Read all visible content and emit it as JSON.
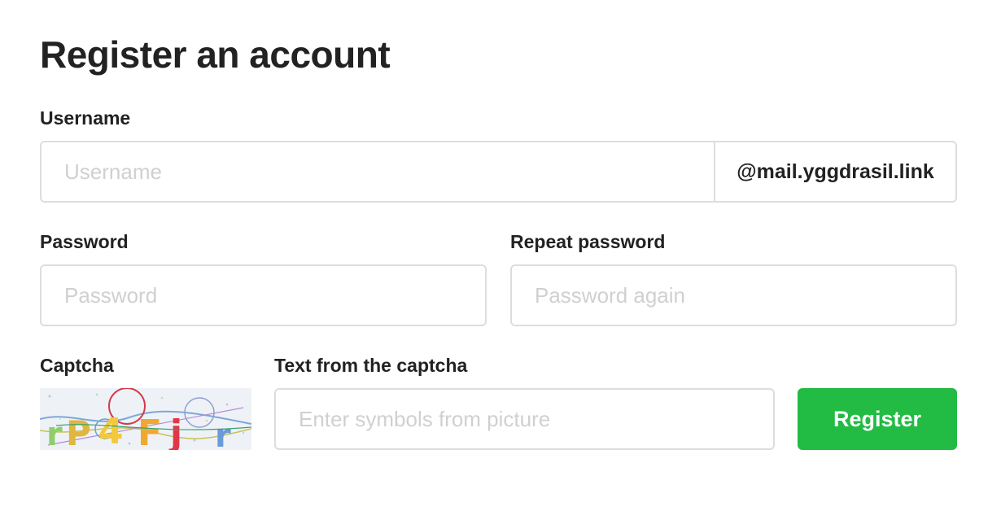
{
  "form": {
    "title": "Register an account",
    "username": {
      "label": "Username",
      "placeholder": "Username",
      "value": "",
      "domain_suffix": "@mail.yggdrasil.link"
    },
    "password": {
      "label": "Password",
      "placeholder": "Password",
      "value": ""
    },
    "repeat_password": {
      "label": "Repeat password",
      "placeholder": "Password again",
      "value": ""
    },
    "captcha": {
      "label": "Captcha",
      "image_text": "rP4Fj r"
    },
    "captcha_text": {
      "label": "Text from the captcha",
      "placeholder": "Enter symbols from picture",
      "value": ""
    },
    "register_label": "Register"
  },
  "colors": {
    "primary_button": "#22bb44",
    "border": "#dddddd",
    "placeholder": "#d0d0d0",
    "text": "#222222"
  }
}
